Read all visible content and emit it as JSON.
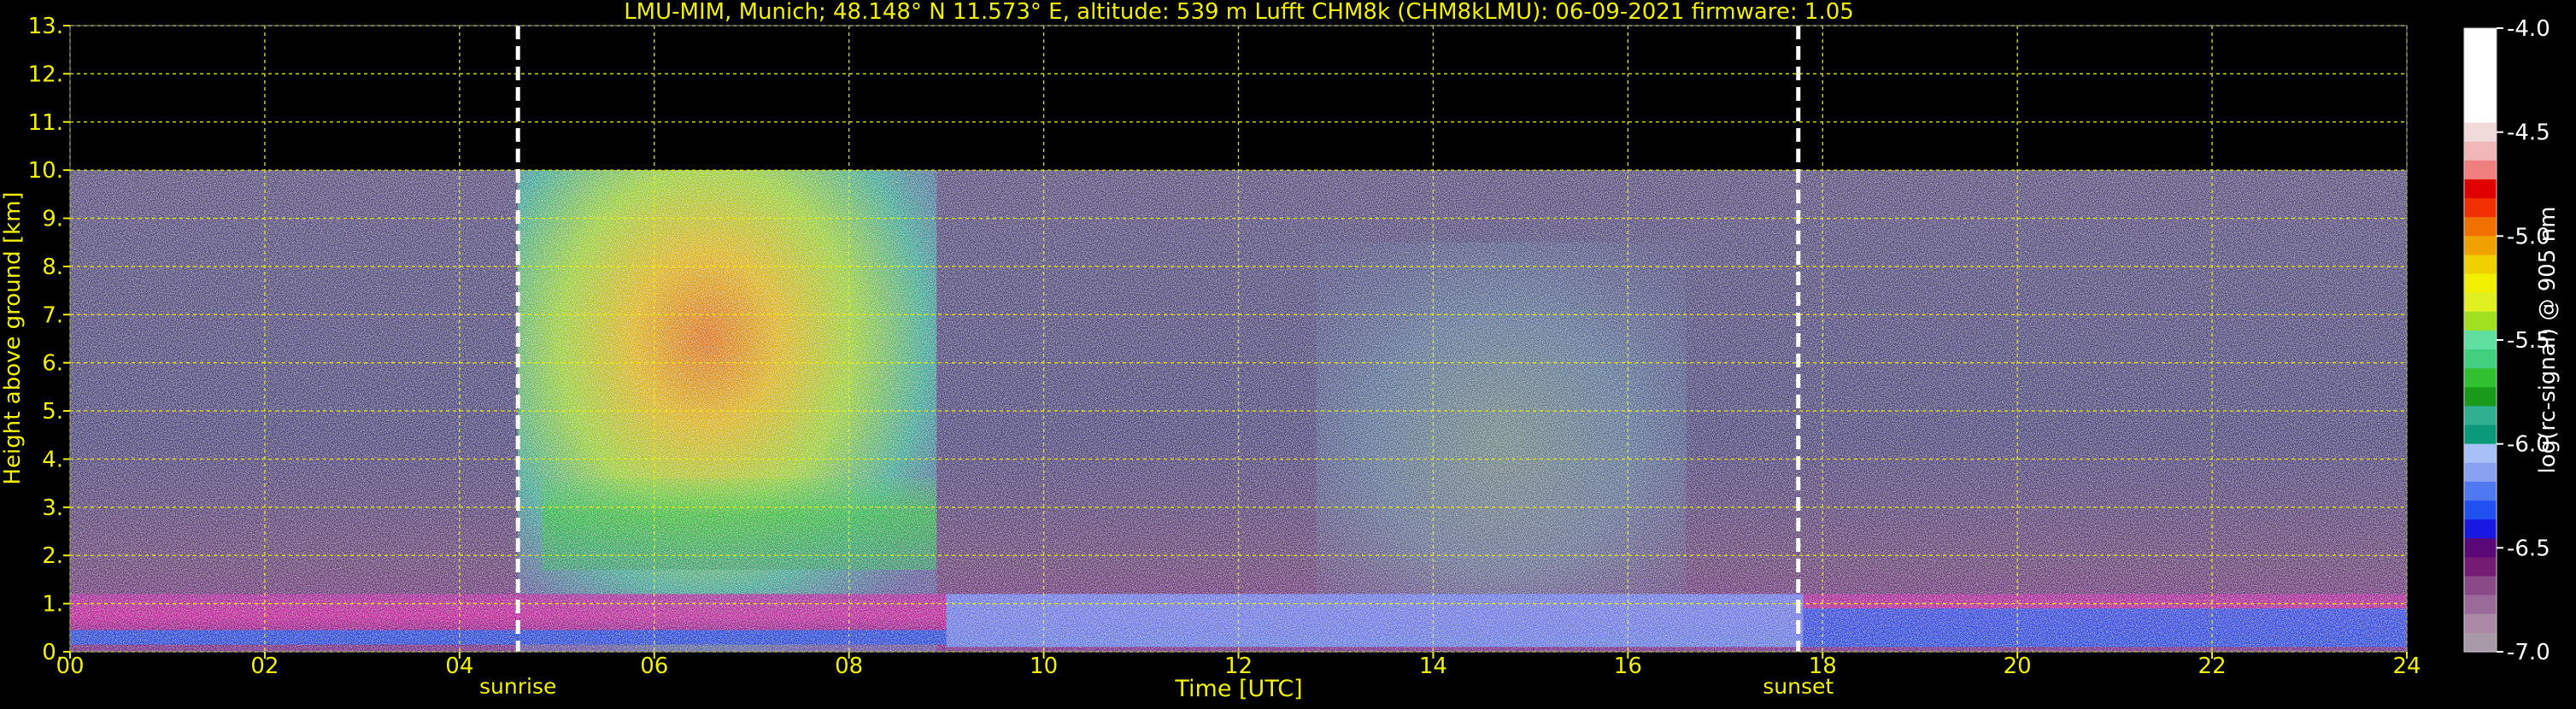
{
  "chart_data": {
    "type": "heatmap",
    "title": "LMU-MIM, Munich; 48.148° N 11.573° E, altitude: 539 m    Lufft CHM8k (CHM8kLMU): 06-09-2021    firmware: 1.05",
    "xlabel": "Time [UTC]",
    "ylabel": "Height above ground [km]",
    "xlim": [
      0,
      24
    ],
    "ylim": [
      0,
      13
    ],
    "x_ticks": [
      "00",
      "02",
      "04",
      "06",
      "08",
      "10",
      "12",
      "14",
      "16",
      "18",
      "20",
      "22",
      "24"
    ],
    "y_ticks": [
      "0.",
      "1.",
      "2.",
      "3.",
      "4.",
      "5.",
      "6.",
      "7.",
      "8.",
      "9.",
      "10.",
      "11.",
      "12.",
      "13."
    ],
    "grid": true,
    "data_top_km": 10,
    "events": [
      {
        "name": "sunrise",
        "time_h": 4.6
      },
      {
        "name": "sunset",
        "time_h": 17.75
      }
    ],
    "colorbar": {
      "label": "log(rc-signal) @ 905 nm",
      "range": [
        -7.0,
        -4.0
      ],
      "ticks": [
        "-4.0",
        "-4.5",
        "-5.0",
        "-5.5",
        "-6.0",
        "-6.5",
        "-7.0"
      ],
      "colors": [
        "#a899a8",
        "#aa88a6",
        "#9a6a98",
        "#8a4a88",
        "#741c74",
        "#5a0878",
        "#1818e0",
        "#2050f0",
        "#5078f0",
        "#8aa0f0",
        "#a8c0f8",
        "#0a9a7a",
        "#30b090",
        "#1a9a1a",
        "#30c030",
        "#40d080",
        "#60e0a0",
        "#a0e020",
        "#e0f020",
        "#f0f000",
        "#f0d000",
        "#f0a000",
        "#f07000",
        "#f03000",
        "#e00000",
        "#f08080",
        "#f0b8b8",
        "#f0dada",
        "#ffffff",
        "#ffffff",
        "#ffffff",
        "#ffffff",
        "#ffffff"
      ]
    }
  }
}
